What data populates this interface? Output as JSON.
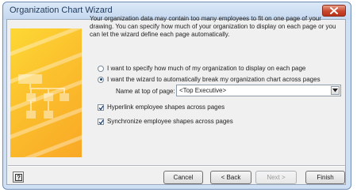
{
  "window": {
    "title": "Organization Chart Wizard"
  },
  "intro_text": "Your organization data may contain too many employees to fit on one page of your drawing.  You can specify how much of your organization to display on each page or you can let the wizard define each page automatically.",
  "options": {
    "manual_label": "I want to specify how much of my organization to display on each page",
    "auto_label": "I want the wizard to automatically break my organization chart across pages",
    "selected": "auto"
  },
  "name_field": {
    "label": "Name at top of page:",
    "value": "<Top Executive>"
  },
  "checkboxes": {
    "hyperlink_label": "Hyperlink employee shapes across pages",
    "hyperlink_checked": true,
    "synchronize_label": "Synchronize employee shapes across pages",
    "synchronize_checked": true
  },
  "buttons": {
    "cancel": "Cancel",
    "back": "< Back",
    "next": "Next >",
    "finish": "Finish"
  },
  "icons": {
    "close": "close-icon",
    "help": "help-icon",
    "dropdown": "chevron-down-icon",
    "art": "org-chart-icon"
  },
  "colors": {
    "art_yellow": "#fbc02d",
    "close_red": "#c8462c",
    "titlebar": "#cfe0f4"
  }
}
